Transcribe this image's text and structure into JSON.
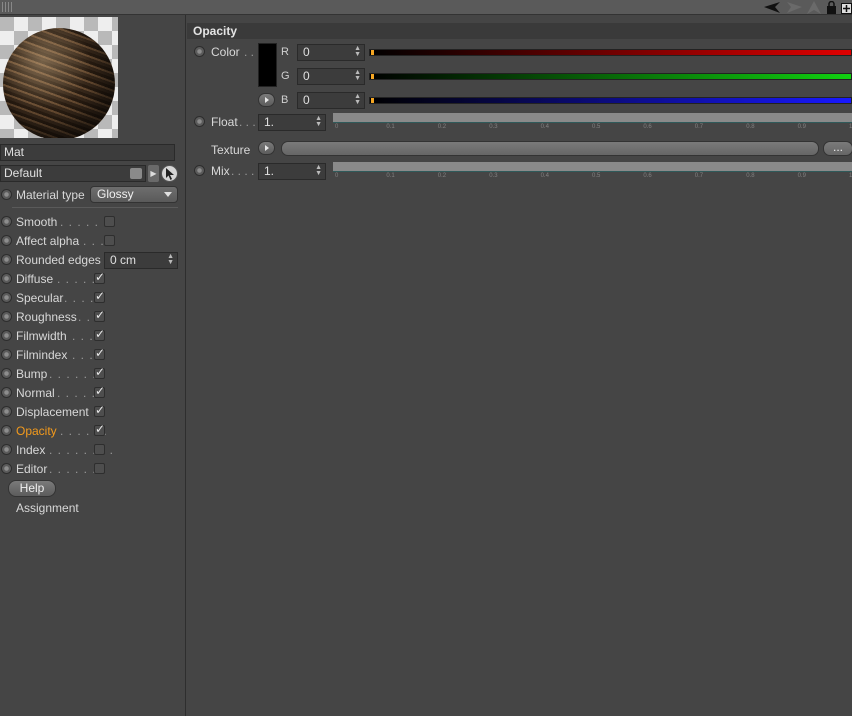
{
  "material": {
    "name": "Mat",
    "layer": "Default",
    "type_label": "Material type",
    "type_value": "Glossy"
  },
  "channels": [
    {
      "label": "Smooth",
      "checked": false,
      "control": "checkbox"
    },
    {
      "label": "Affect alpha",
      "checked": false,
      "control": "checkbox"
    },
    {
      "label": "Rounded edges",
      "control": "field",
      "value": "0 cm"
    },
    {
      "label": "Diffuse",
      "checked": true,
      "control": "checkbox"
    },
    {
      "label": "Specular",
      "checked": true,
      "control": "checkbox"
    },
    {
      "label": "Roughness",
      "checked": true,
      "control": "checkbox"
    },
    {
      "label": "Filmwidth",
      "checked": true,
      "control": "checkbox"
    },
    {
      "label": "Filmindex",
      "checked": true,
      "control": "checkbox"
    },
    {
      "label": "Bump",
      "checked": true,
      "control": "checkbox"
    },
    {
      "label": "Normal",
      "checked": true,
      "control": "checkbox"
    },
    {
      "label": "Displacement",
      "checked": true,
      "control": "checkbox"
    },
    {
      "label": "Opacity",
      "checked": true,
      "control": "checkbox",
      "active": true
    },
    {
      "label": "Index",
      "checked": false,
      "control": "checkbox"
    },
    {
      "label": "Editor",
      "checked": false,
      "control": "checkbox"
    }
  ],
  "buttons": {
    "help": "Help",
    "assignment": "Assignment"
  },
  "opacity": {
    "section_title": "Opacity",
    "color_label": "Color",
    "color_rgb": [
      {
        "letter": "R",
        "value": "0"
      },
      {
        "letter": "G",
        "value": "0"
      },
      {
        "letter": "B",
        "value": "0"
      }
    ],
    "float_label": "Float",
    "float_value": "1.",
    "texture_label": "Texture",
    "texture_more": "...",
    "mix_label": "Mix",
    "mix_value": "1.",
    "slider_ticks": [
      "0",
      "0.1",
      "0.2",
      "0.3",
      "0.4",
      "0.5",
      "0.6",
      "0.7",
      "0.8",
      "0.9",
      "1"
    ],
    "slider_level": 1.0
  },
  "colors": {
    "accent_active": "#f39a1c",
    "red": "#e00000",
    "green": "#10d010",
    "blue": "#1818ff"
  }
}
